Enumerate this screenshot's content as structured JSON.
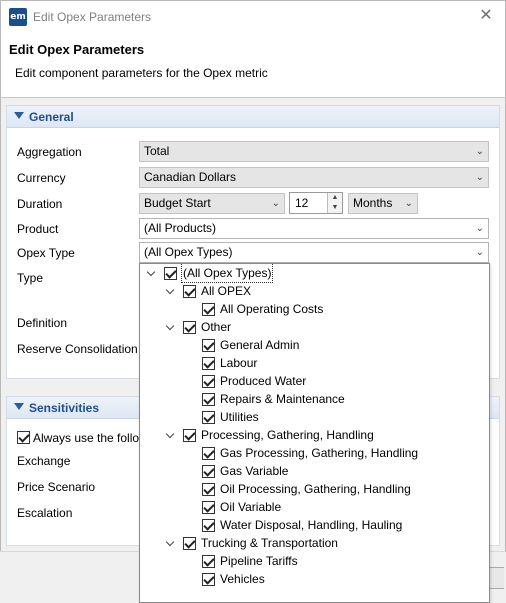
{
  "window": {
    "title": "Edit Opex Parameters",
    "logo_text": "em"
  },
  "header": {
    "title": "Edit Opex Parameters",
    "subtitle": "Edit component parameters for the Opex metric"
  },
  "general": {
    "section_label": "General",
    "aggregation_label": "Aggregation",
    "aggregation_value": "Total",
    "currency_label": "Currency",
    "currency_value": "Canadian Dollars",
    "duration_label": "Duration",
    "duration_start": "Budget Start",
    "duration_count": "12",
    "duration_unit": "Months",
    "product_label": "Product",
    "product_value": "(All Products)",
    "opex_type_label": "Opex Type",
    "opex_type_value": "(All Opex Types)",
    "type_label": "Type",
    "definition_label": "Definition",
    "reserve_label": "Reserve Consolidation"
  },
  "sensitivities": {
    "section_label": "Sensitivities",
    "always_use_label": "Always use the follo",
    "exchange_label": "Exchange",
    "price_label": "Price Scenario",
    "escalation_label": "Escalation"
  },
  "tree": {
    "root": "(All Opex Types)",
    "all_opex": "All OPEX",
    "all_operating_costs": "All Operating Costs",
    "other": "Other",
    "general_admin": "General Admin",
    "labour": "Labour",
    "produced_water": "Produced Water",
    "repairs": "Repairs & Maintenance",
    "utilities": "Utilities",
    "processing": "Processing, Gathering, Handling",
    "gas_processing": "Gas Processing, Gathering, Handling",
    "gas_variable": "Gas Variable",
    "oil_processing": "Oil Processing, Gathering, Handling",
    "oil_variable": "Oil Variable",
    "water_disposal": "Water Disposal, Handling, Hauling",
    "trucking": "Trucking & Transportation",
    "pipeline_tariffs": "Pipeline Tariffs",
    "vehicles": "Vehicles"
  },
  "colors": {
    "section_title": "#1f4f8f",
    "logo_bg": "#1b4e8c"
  }
}
